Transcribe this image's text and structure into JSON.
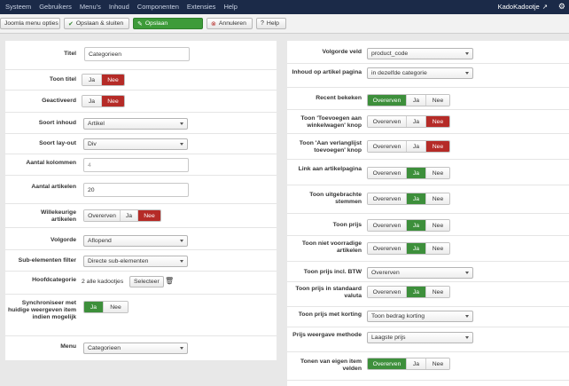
{
  "topbar": {
    "menu": [
      "Systeem",
      "Gebruikers",
      "Menu's",
      "Inhoud",
      "Componenten",
      "Extensies",
      "Help"
    ],
    "site": "KadoKadootje",
    "colors": {
      "bg": "#1b2a48"
    }
  },
  "toolbar": {
    "buttons": [
      {
        "label": "Joomla menu opties",
        "icon": "none"
      },
      {
        "label": "Opslaan & sluiten",
        "icon": "check-icon"
      },
      {
        "label": "Opslaan",
        "icon": "edit-icon"
      },
      {
        "label": "Annuleren",
        "icon": "cancel-icon"
      },
      {
        "label": "Help",
        "icon": "help-icon"
      }
    ]
  },
  "left": {
    "titel_label": "Titel",
    "titel_value": "Categorieen",
    "toon_titel_label": "Toon titel",
    "toon_titel": [
      "Ja",
      "Nee"
    ],
    "uitgelicht_label": "Geactiveerd",
    "uitgelicht": [
      "Ja",
      "Nee"
    ],
    "soort_inhoud_label": "Soort inhoud",
    "soort_inhoud": "Artikel",
    "soort_layout_label": "Soort lay-out",
    "soort_layout": "Div",
    "kolommen_label": "Aantal kolommen",
    "kolommen": "4",
    "artikelen_label": "Aantal artikelen",
    "artikelen": "20",
    "willekeurig_label": "Willekeurige artikelen",
    "willekeurig": [
      "Overerven",
      "Ja",
      "Nee"
    ],
    "volgorde_label": "Volgorde",
    "volgorde": "Aflopend",
    "subfilter_label": "Sub-elementen filter",
    "subfilter": "Directe sub-elementen",
    "hoofdcat_label": "Hoofdcategorie",
    "hoofdcat_value": "2 alle kadootjes",
    "hoofdcat_btn": "Selecteer",
    "sync_label": "Synchroniseer met huidige weergeven item indien mogelijk",
    "sync": [
      "Ja",
      "Nee"
    ],
    "menu_label": "Menu",
    "menu_value": "Categorieen"
  },
  "right": {
    "volgorde_veld_label": "Volgorde veld",
    "volgorde_veld": "product_code",
    "inhoud_label": "Inhoud op artikel pagina",
    "inhoud": "in dezelfde categorie",
    "recent_label": "Recent bekeken",
    "recent": [
      "Overerven",
      "Ja",
      "Nee"
    ],
    "toevoegen_label": "Toon 'Toevoegen aan winkelwagen' knop",
    "toevoegen": [
      "Overerven",
      "Ja",
      "Nee"
    ],
    "verlanglijst_label": "Toon 'Aan verlanglijst toevoegen' knop",
    "verlanglijst": [
      "Overerven",
      "Ja",
      "Nee"
    ],
    "link_label": "Link aan artikelpagina",
    "link": [
      "Overerven",
      "Ja",
      "Nee"
    ],
    "stemmen_label": "Toon uitgebrachte stemmen",
    "stemmen": [
      "Overerven",
      "Ja",
      "Nee"
    ],
    "prijs_label": "Toon prijs",
    "prijs": [
      "Overerven",
      "Ja",
      "Nee"
    ],
    "voorradig_label": "Toon niet voorradige artikelen",
    "voorradig": [
      "Overerven",
      "Ja",
      "Nee"
    ],
    "btw_label": "Toon prijs incl. BTW",
    "btw": "Overerven",
    "valuta_label": "Toon prijs in standaard valuta",
    "valuta": [
      "Overerven",
      "Ja",
      "Nee"
    ],
    "korting_label": "Toon prijs met korting",
    "korting": "Toon bedrag korting",
    "methode_label": "Prijs weergave methode",
    "methode": "Laagste prijs",
    "eigen_label": "Tonen van eigen item velden",
    "eigen": [
      "Overerven",
      "Ja",
      "Nee"
    ]
  }
}
